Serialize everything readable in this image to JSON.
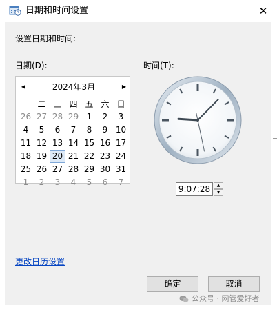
{
  "window": {
    "title": "日期和时间设置",
    "close_glyph": "✕",
    "app_icon": "datetime-settings-icon"
  },
  "dialog": {
    "section_label": "设置日期和时间:",
    "date_label": "日期(D):",
    "time_label": "时间(T):"
  },
  "calendar": {
    "month_title": "2024年3月",
    "prev_glyph": "◀",
    "next_glyph": "▶",
    "weekdays": [
      "一",
      "二",
      "三",
      "四",
      "五",
      "六",
      "日"
    ],
    "weeks": [
      [
        {
          "d": "26",
          "other": true
        },
        {
          "d": "27",
          "other": true
        },
        {
          "d": "28",
          "other": true
        },
        {
          "d": "29",
          "other": true
        },
        {
          "d": "1"
        },
        {
          "d": "2"
        },
        {
          "d": "3"
        }
      ],
      [
        {
          "d": "4"
        },
        {
          "d": "5"
        },
        {
          "d": "6"
        },
        {
          "d": "7"
        },
        {
          "d": "8"
        },
        {
          "d": "9"
        },
        {
          "d": "10"
        }
      ],
      [
        {
          "d": "11"
        },
        {
          "d": "12"
        },
        {
          "d": "13"
        },
        {
          "d": "14"
        },
        {
          "d": "15"
        },
        {
          "d": "16"
        },
        {
          "d": "17"
        }
      ],
      [
        {
          "d": "18"
        },
        {
          "d": "19"
        },
        {
          "d": "20",
          "today": true
        },
        {
          "d": "21"
        },
        {
          "d": "22"
        },
        {
          "d": "23"
        },
        {
          "d": "24"
        }
      ],
      [
        {
          "d": "25"
        },
        {
          "d": "26"
        },
        {
          "d": "27"
        },
        {
          "d": "28"
        },
        {
          "d": "29"
        },
        {
          "d": "30"
        },
        {
          "d": "31"
        }
      ],
      [
        {
          "d": "1",
          "other": true
        },
        {
          "d": "2",
          "other": true
        },
        {
          "d": "3",
          "other": true
        },
        {
          "d": "4",
          "other": true
        },
        {
          "d": "5",
          "other": true
        },
        {
          "d": "6",
          "other": true
        },
        {
          "d": "7",
          "other": true
        }
      ]
    ],
    "selected_color": "#dce9f7"
  },
  "clock": {
    "hour": 9,
    "minute": 7,
    "second": 28
  },
  "time_input": {
    "value": "9:07:28",
    "up_glyph": "▲",
    "down_glyph": "▼"
  },
  "links": {
    "change_calendar_settings": "更改日历设置"
  },
  "buttons": {
    "ok": "确定",
    "cancel": "取消"
  },
  "watermark": {
    "text": "公众号 · 网管爱好者",
    "icon": "wechat-icon"
  },
  "colors": {
    "link": "#0645c2",
    "dialog_bg": "#f0f0f0"
  }
}
